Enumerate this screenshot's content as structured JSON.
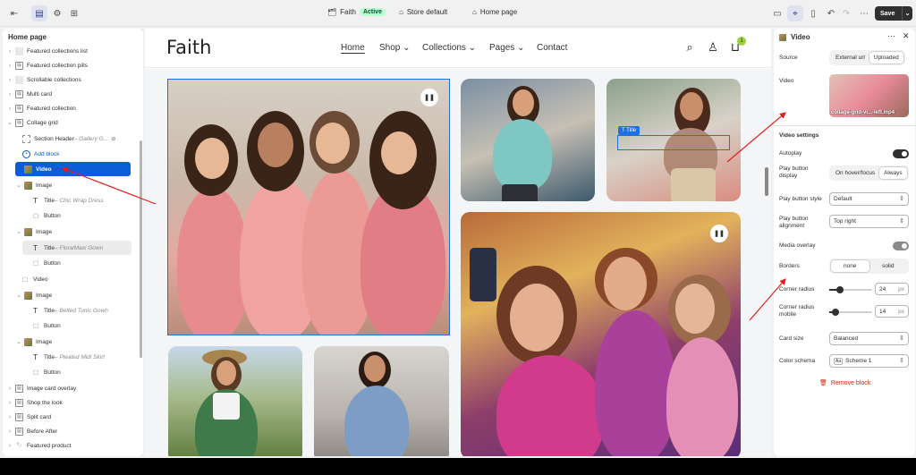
{
  "topbar": {
    "store_name": "Faith",
    "status": "Active",
    "store_default": "Store default",
    "page": "Home page",
    "save_label": "Save"
  },
  "left_panel": {
    "title": "Home page",
    "items": [
      {
        "label": "Featured collections list",
        "sub": ""
      },
      {
        "label": "Featured collection pills",
        "sub": ""
      },
      {
        "label": "Scrollable collections",
        "sub": ""
      },
      {
        "label": "Multi card",
        "sub": ""
      },
      {
        "label": "Featured collection",
        "sub": ""
      },
      {
        "label": "Collage grid",
        "sub": ""
      },
      {
        "label": "Section Header",
        "sub": " – Gallery G..."
      },
      {
        "label": "Add block",
        "sub": ""
      },
      {
        "label": "Video",
        "sub": ""
      },
      {
        "label": "Image",
        "sub": ""
      },
      {
        "label": "Title",
        "sub": " – Chic Wrap Dress"
      },
      {
        "label": "Button",
        "sub": ""
      },
      {
        "label": "Image",
        "sub": ""
      },
      {
        "label": "Title",
        "sub": " – FloralMaxi Gown"
      },
      {
        "label": "Button",
        "sub": ""
      },
      {
        "label": "Video",
        "sub": ""
      },
      {
        "label": "Image",
        "sub": ""
      },
      {
        "label": "Title",
        "sub": " – Belted Tunic Gown"
      },
      {
        "label": "Button",
        "sub": ""
      },
      {
        "label": "Image",
        "sub": ""
      },
      {
        "label": "Title",
        "sub": " – Pleated Midi Skirt"
      },
      {
        "label": "Button",
        "sub": ""
      },
      {
        "label": "Image card overlay",
        "sub": ""
      },
      {
        "label": "Shop the look",
        "sub": ""
      },
      {
        "label": "Split card",
        "sub": ""
      },
      {
        "label": "Before After",
        "sub": ""
      },
      {
        "label": "Featured product",
        "sub": ""
      }
    ]
  },
  "store": {
    "logo": "Faith",
    "nav": [
      "Home",
      "Shop",
      "Collections",
      "Pages",
      "Contact"
    ],
    "cart_count": "1",
    "title_chip": "Title"
  },
  "right_panel": {
    "title": "Video",
    "source_label": "Source",
    "source_options": [
      "External url",
      "Uploaded"
    ],
    "video_label": "Video",
    "video_filename": "collage-grid-vi...-left.mp4",
    "settings_heading": "Video settings",
    "autoplay_label": "Autoplay",
    "play_display_label": "Play button display",
    "play_display_options": [
      "On hover/focus",
      "Always"
    ],
    "play_style_label": "Play button style",
    "play_style_value": "Default",
    "play_align_label": "Play button alignment",
    "play_align_value": "Top right",
    "media_overlay_label": "Media overlay",
    "borders_label": "Borders",
    "borders_options": [
      "none",
      "solid"
    ],
    "corner_radius_label": "Corner radius",
    "corner_radius_value": "24",
    "corner_radius_mobile_label": "Corner radius mobile",
    "corner_radius_mobile_value": "14",
    "unit": "px",
    "card_size_label": "Card size",
    "card_size_value": "Balanced",
    "color_schema_label": "Color schema",
    "color_schema_value": "Scheme 1",
    "color_schema_swatch": "Aa",
    "remove_label": "Remove block"
  },
  "colors": {
    "accent": "#0b5cd7",
    "danger": "#c5280c",
    "annotation": "#e02020"
  },
  "controls": {
    "autoplay_on": true,
    "media_overlay_on": true,
    "corner_radius_fraction": 0.24,
    "corner_radius_mobile_fraction": 0.14
  }
}
